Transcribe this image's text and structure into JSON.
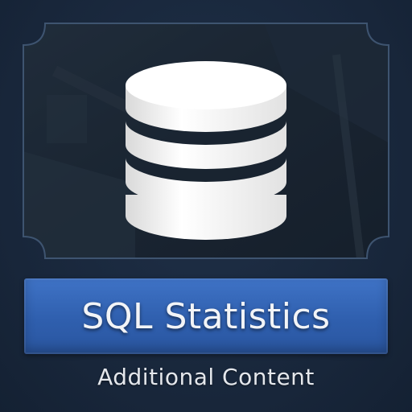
{
  "card": {
    "title": "SQL Statistics",
    "subtitle": "Additional Content",
    "icon": "database-icon",
    "colors": {
      "background": "#1b2a3d",
      "banner": "#3366b8",
      "frame_border": "#3a4e66",
      "icon": "#f4f4f4"
    }
  }
}
